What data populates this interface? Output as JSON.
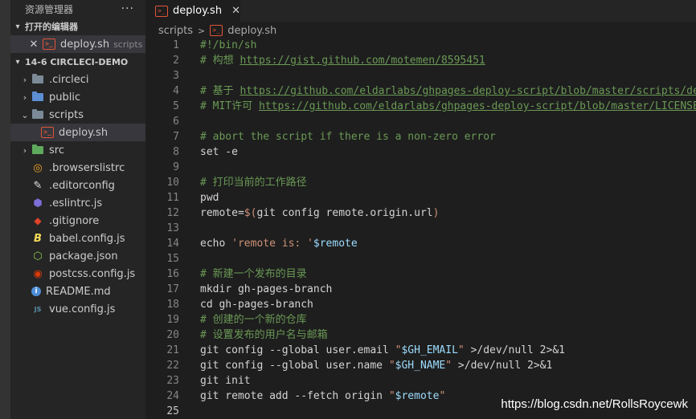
{
  "explorer": {
    "title": "资源管理器",
    "more": "···",
    "open_editors": {
      "label": "打开的编辑器",
      "items": [
        {
          "name": "deploy.sh",
          "folder": "scripts"
        }
      ]
    },
    "project": {
      "label": "14-6 CIRCLECI-DEMO",
      "entries": [
        {
          "name": ".circleci",
          "kind": "folder",
          "icon": "folder-circleci-icon"
        },
        {
          "name": "public",
          "kind": "folder",
          "icon": "folder-public-icon"
        },
        {
          "name": "scripts",
          "kind": "folder-open",
          "icon": "folder-scripts-icon"
        },
        {
          "name": "deploy.sh",
          "kind": "file",
          "icon": "shell-icon"
        },
        {
          "name": "src",
          "kind": "folder",
          "icon": "folder-src-icon"
        },
        {
          "name": ".browserslistrc",
          "kind": "file",
          "icon": "browserslist-icon"
        },
        {
          "name": ".editorconfig",
          "kind": "file",
          "icon": "editorconfig-icon"
        },
        {
          "name": ".eslintrc.js",
          "kind": "file",
          "icon": "eslint-icon"
        },
        {
          "name": ".gitignore",
          "kind": "file",
          "icon": "git-icon"
        },
        {
          "name": "babel.config.js",
          "kind": "file",
          "icon": "babel-icon"
        },
        {
          "name": "package.json",
          "kind": "file",
          "icon": "nodejs-icon"
        },
        {
          "name": "postcss.config.js",
          "kind": "file",
          "icon": "postcss-icon"
        },
        {
          "name": "README.md",
          "kind": "file",
          "icon": "info-icon"
        },
        {
          "name": "vue.config.js",
          "kind": "file",
          "icon": "js-file-icon"
        }
      ]
    }
  },
  "tab": {
    "name": "deploy.sh",
    "close": "✕"
  },
  "breadcrumb": {
    "folder": "scripts",
    "file": "deploy.sh"
  },
  "sh_badge": ">_",
  "code_lines": [
    [
      [
        "#!/bin/sh",
        "com"
      ]
    ],
    [
      [
        "# 构想 ",
        "com"
      ],
      [
        "https://gist.github.com/motemen/8595451",
        "link"
      ]
    ],
    [],
    [
      [
        "# 基于 ",
        "com"
      ],
      [
        "https://github.com/eldarlabs/ghpages-deploy-script/blob/master/scripts/deploy-ghpages.sh",
        "link"
      ]
    ],
    [
      [
        "# MIT许可 ",
        "com"
      ],
      [
        "https://github.com/eldarlabs/ghpages-deploy-script/blob/master/LICENSE",
        "link"
      ]
    ],
    [],
    [
      [
        "# abort the script if there is a non-zero error",
        "com"
      ]
    ],
    [
      [
        "set -e",
        "def"
      ]
    ],
    [],
    [
      [
        "# 打印当前的工作路径",
        "com"
      ]
    ],
    [
      [
        "pwd",
        "def"
      ]
    ],
    [
      [
        "remote=",
        "def"
      ],
      [
        "$(",
        "str"
      ],
      [
        "git config remote.origin.url",
        "def"
      ],
      [
        ")",
        "str"
      ]
    ],
    [],
    [
      [
        "echo ",
        "def"
      ],
      [
        "'remote is: '",
        "str"
      ],
      [
        "$remote",
        "var"
      ]
    ],
    [],
    [
      [
        "# 新建一个发布的目录",
        "com"
      ]
    ],
    [
      [
        "mkdir gh-pages-branch",
        "def"
      ]
    ],
    [
      [
        "cd gh-pages-branch",
        "def"
      ]
    ],
    [
      [
        "# 创建的一个新的仓库",
        "com"
      ]
    ],
    [
      [
        "# 设置发布的用户名与邮箱",
        "com"
      ]
    ],
    [
      [
        "git config --global user.email ",
        "def"
      ],
      [
        "\"",
        "str"
      ],
      [
        "$GH_EMAIL",
        "var"
      ],
      [
        "\"",
        "str"
      ],
      [
        " >/dev/null 2>&1",
        "def"
      ]
    ],
    [
      [
        "git config --global user.name ",
        "def"
      ],
      [
        "\"",
        "str"
      ],
      [
        "$GH_NAME",
        "var"
      ],
      [
        "\"",
        "str"
      ],
      [
        " >/dev/null 2>&1",
        "def"
      ]
    ],
    [
      [
        "git init",
        "def"
      ]
    ],
    [
      [
        "git remote add --fetch origin ",
        "def"
      ],
      [
        "\"",
        "str"
      ],
      [
        "$remote",
        "var"
      ],
      [
        "\"",
        "str"
      ]
    ],
    []
  ],
  "line_numbers": [
    "1",
    "2",
    "3",
    "4",
    "5",
    "6",
    "7",
    "8",
    "9",
    "10",
    "11",
    "12",
    "13",
    "14",
    "15",
    "16",
    "17",
    "18",
    "19",
    "20",
    "21",
    "22",
    "23",
    "24",
    "25"
  ],
  "watermark": "https://blog.csdn.net/RollsRoycewk"
}
